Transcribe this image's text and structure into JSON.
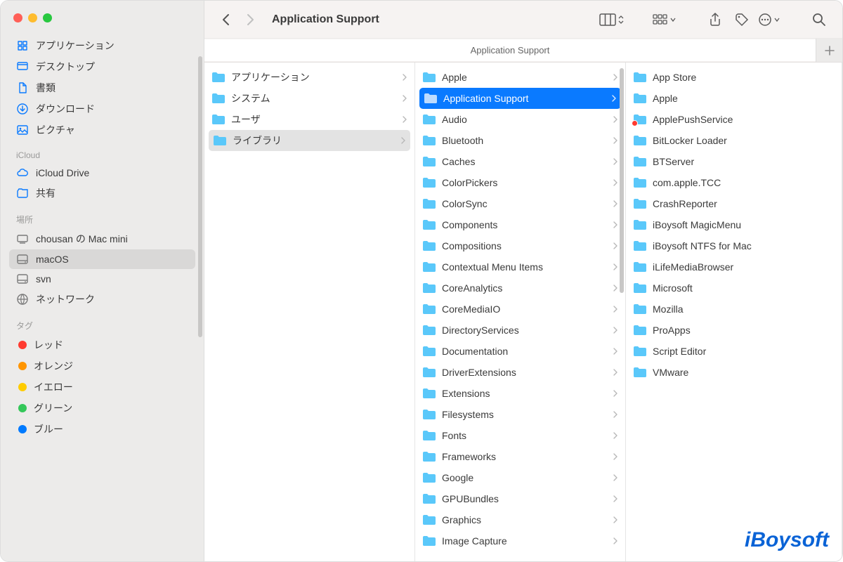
{
  "window": {
    "title": "Application Support"
  },
  "tabbar": {
    "active_tab": "Application Support"
  },
  "sidebar": {
    "favorites": [
      {
        "icon": "app-icon",
        "label": "アプリケーション"
      },
      {
        "icon": "desktop-icon",
        "label": "デスクトップ"
      },
      {
        "icon": "doc-icon",
        "label": "書類"
      },
      {
        "icon": "download-icon",
        "label": "ダウンロード"
      },
      {
        "icon": "picture-icon",
        "label": "ピクチャ"
      }
    ],
    "icloud_label": "iCloud",
    "icloud": [
      {
        "icon": "cloud-icon",
        "label": "iCloud Drive"
      },
      {
        "icon": "shared-icon",
        "label": "共有"
      }
    ],
    "locations_label": "場所",
    "locations": [
      {
        "icon": "mac-icon",
        "label": "chousan の Mac mini"
      },
      {
        "icon": "disk-icon",
        "label": "macOS",
        "selected": true
      },
      {
        "icon": "disk-icon",
        "label": "svn"
      },
      {
        "icon": "globe-icon",
        "label": "ネットワーク"
      }
    ],
    "tags_label": "タグ",
    "tags": [
      {
        "color": "#ff3b30",
        "label": "レッド"
      },
      {
        "color": "#ff9500",
        "label": "オレンジ"
      },
      {
        "color": "#ffcc00",
        "label": "イエロー"
      },
      {
        "color": "#34c759",
        "label": "グリーン"
      },
      {
        "color": "#007aff",
        "label": "ブルー"
      }
    ]
  },
  "columns": {
    "c1": [
      {
        "label": "アプリケーション"
      },
      {
        "label": "システム"
      },
      {
        "label": "ユーザ"
      },
      {
        "label": "ライブラリ",
        "active": true
      }
    ],
    "c2": [
      {
        "label": "Apple"
      },
      {
        "label": "Application Support",
        "selected": true
      },
      {
        "label": "Audio"
      },
      {
        "label": "Bluetooth"
      },
      {
        "label": "Caches"
      },
      {
        "label": "ColorPickers"
      },
      {
        "label": "ColorSync"
      },
      {
        "label": "Components"
      },
      {
        "label": "Compositions"
      },
      {
        "label": "Contextual Menu Items"
      },
      {
        "label": "CoreAnalytics"
      },
      {
        "label": "CoreMediaIO"
      },
      {
        "label": "DirectoryServices"
      },
      {
        "label": "Documentation"
      },
      {
        "label": "DriverExtensions"
      },
      {
        "label": "Extensions"
      },
      {
        "label": "Filesystems"
      },
      {
        "label": "Fonts"
      },
      {
        "label": "Frameworks"
      },
      {
        "label": "Google"
      },
      {
        "label": "GPUBundles"
      },
      {
        "label": "Graphics"
      },
      {
        "label": "Image Capture"
      }
    ],
    "c3": [
      {
        "label": "App Store"
      },
      {
        "label": "Apple"
      },
      {
        "label": "ApplePushService",
        "badge": true
      },
      {
        "label": "BitLocker Loader"
      },
      {
        "label": "BTServer"
      },
      {
        "label": "com.apple.TCC"
      },
      {
        "label": "CrashReporter"
      },
      {
        "label": "iBoysoft MagicMenu"
      },
      {
        "label": "iBoysoft NTFS for Mac"
      },
      {
        "label": "iLifeMediaBrowser"
      },
      {
        "label": "Microsoft"
      },
      {
        "label": "Mozilla"
      },
      {
        "label": "ProApps"
      },
      {
        "label": "Script Editor"
      },
      {
        "label": "VMware"
      }
    ]
  },
  "watermark": "iBoysoft"
}
